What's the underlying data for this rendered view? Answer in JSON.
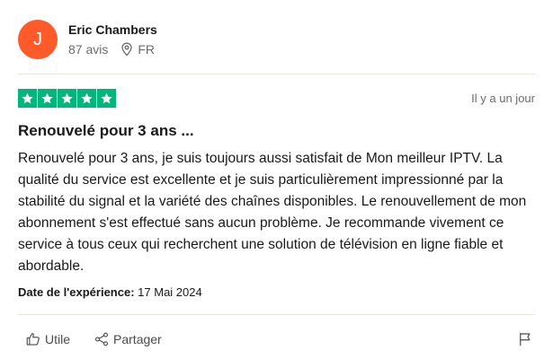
{
  "reviewer": {
    "initial": "J",
    "name": "Eric Chambers",
    "review_count": "87 avis",
    "country": "FR",
    "avatar_color": "#ff5a29"
  },
  "review": {
    "rating": 5,
    "rating_max": 5,
    "star_color": "#00b67a",
    "posted_ago": "Il y a un jour",
    "title": "Renouvelé pour 3 ans ...",
    "body": "Renouvelé pour 3 ans, je suis toujours aussi satisfait de Mon meilleur IPTV. La qualité du service est excellente et je suis particulièrement impressionné par la stabilité du signal et la variété des chaînes disponibles. Le renouvellement de mon abonnement s'est effectué sans aucun problème. Je recommande vivement ce service à tous ceux qui recherchent une solution de télévision en ligne fiable et abordable.",
    "experience_label": "Date de l'expérience:",
    "experience_date": "17 Mai 2024"
  },
  "actions": {
    "useful_label": "Utile",
    "share_label": "Partager"
  },
  "icons": {
    "location": "location-pin-icon",
    "star": "star-icon",
    "useful": "thumbs-up-icon",
    "share": "share-icon",
    "report": "flag-icon"
  }
}
